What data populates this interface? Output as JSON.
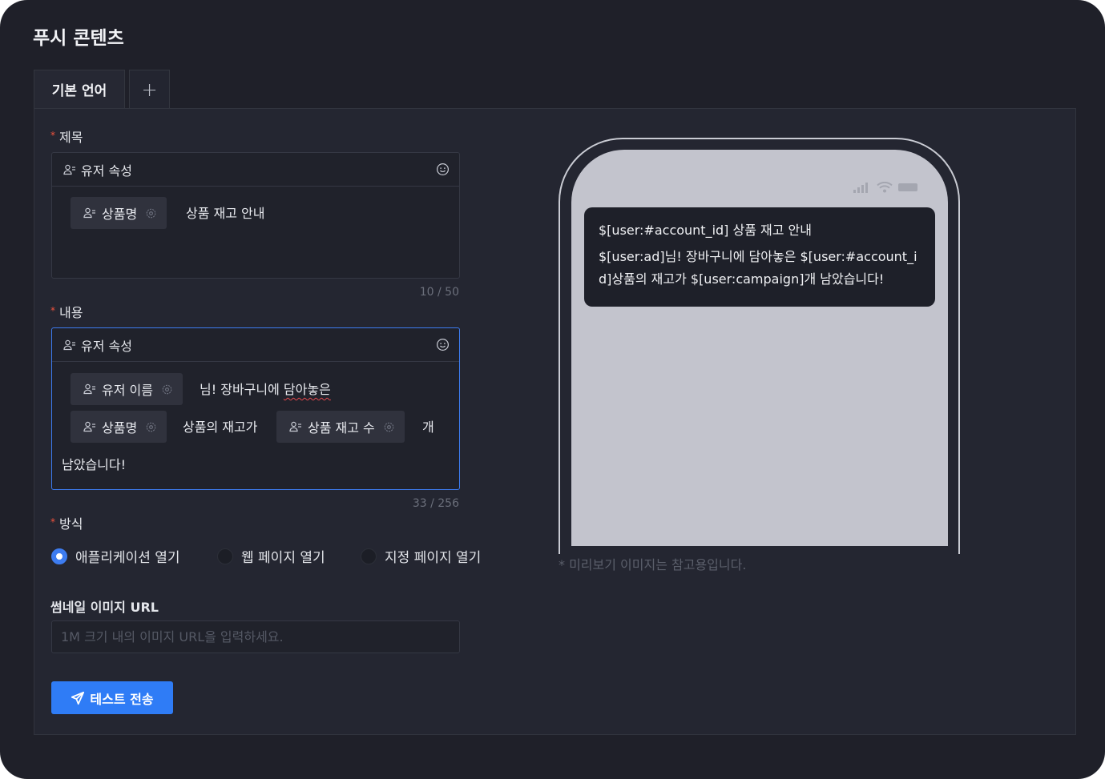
{
  "page_title": "푸시 콘텐츠",
  "tabs": {
    "default_language": "기본 언어",
    "add": "+"
  },
  "title_field": {
    "label": "제목",
    "toolbar_label": "유저 속성",
    "chip_product_name": "상품명",
    "text": "상품 재고 안내",
    "counter": "10 / 50"
  },
  "content_field": {
    "label": "내용",
    "toolbar_label": "유저 속성",
    "chip_user_name": "유저 이름",
    "text_1": "님! 장바구니에 ",
    "text_1_misspelled": "담아놓은",
    "chip_product_name": "상품명",
    "text_2": "상품의 재고가",
    "chip_stock_count": "상품 재고 수",
    "text_3": "개",
    "text_4": "남았습니다!",
    "counter": "33 / 256"
  },
  "method": {
    "label": "방식",
    "options": [
      "애플리케이션 열기",
      "웹 페이지 열기",
      "지정 페이지 열기"
    ],
    "selected": "애플리케이션 열기"
  },
  "thumbnail": {
    "label": "썸네일 이미지 URL",
    "placeholder": "1M 크기 내의 이미지 URL을 입력하세요.",
    "value": ""
  },
  "send_button": "테스트 전송",
  "preview": {
    "title": "$[user:#account_id] 상품 재고 안내",
    "body": "$[user:ad]님! 장바구니에 담아놓은 $[user:#account_id]상품의 재고가 $[user:campaign]개 남았습니다!",
    "note": "* 미리보기 이미지는 참고용입니다."
  },
  "colors": {
    "background": "#1f2029",
    "panel": "#242631",
    "accent": "#2f7cf6",
    "required": "#f0533d",
    "phone_screen": "#c3c4cd"
  },
  "icons": [
    "user-attribute-icon",
    "emoji-icon",
    "gear-icon",
    "plus-icon",
    "send-icon",
    "signal-icon",
    "wifi-icon",
    "battery-icon"
  ]
}
